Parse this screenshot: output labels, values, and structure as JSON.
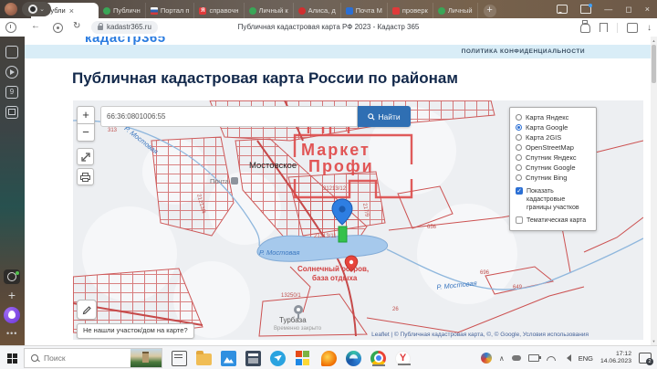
{
  "browser": {
    "tabs": [
      {
        "label": "Публи",
        "active": true
      },
      {
        "label": "Публичн"
      },
      {
        "label": "Портал п"
      },
      {
        "label": "справочн"
      },
      {
        "label": "Личный к"
      },
      {
        "label": "Алиса, д"
      },
      {
        "label": "Почта М"
      },
      {
        "label": "проверк"
      },
      {
        "label": "Личный"
      }
    ],
    "url": "kadastr365.ru",
    "page_title": "Публичная кадастровая карта РФ 2023 - Кадастр 365"
  },
  "site": {
    "logo": "кадастр365",
    "privacy": "ПОЛИТИКА КОНФИДЕНЦИАЛЬНОСТИ",
    "heading": "Публичная кадастровая карта России по районам"
  },
  "map": {
    "search": {
      "value": "66:36:0801006:55",
      "button": "Найти"
    },
    "zoom_in": "+",
    "zoom_out": "−",
    "not_found": "Не нашли участок/дом на карте?",
    "attribution": "Leaflet | © Публичная кадастровая карта, ©, © Google, Условия использования",
    "watermark": {
      "line1": "Маркет",
      "line2": "Профи"
    },
    "layers": {
      "options": [
        "Карта Яндекс",
        "Карта Google",
        "Карта 2GIS",
        "OpenStreetMap",
        "Спутник Яндекс",
        "Спутник Google",
        "Спутник Bing"
      ],
      "selected_index": 1,
      "checkboxes": [
        {
          "label": "Показать кадастровые границы участков",
          "checked": true
        },
        {
          "label": "Тематическая карта",
          "checked": false
        }
      ]
    },
    "labels": [
      {
        "text": "Мостовское"
      },
      {
        "text": "Почта"
      },
      {
        "text": "Р. Мостовая"
      },
      {
        "text": "Р. Мостовая"
      },
      {
        "text": "Р. Мостовая"
      },
      {
        "text": "Солнечный остров,"
      },
      {
        "text": "база отдыха"
      },
      {
        "text": "Турбаза"
      },
      {
        "text": "Временно закрыто"
      },
      {
        "text": "313"
      },
      {
        "text": "21213/12"
      },
      {
        "text": "21213/11"
      },
      {
        "text": "13250/1"
      },
      {
        "text": "656"
      },
      {
        "text": "696"
      },
      {
        "text": "649"
      },
      {
        "text": "26"
      },
      {
        "text": "21213/4"
      },
      {
        "text": "217/9"
      }
    ]
  },
  "taskbar": {
    "search_placeholder": "Поиск",
    "language": "ENG",
    "time": "17:12",
    "date": "14.06.2023",
    "notifications": "2"
  }
}
